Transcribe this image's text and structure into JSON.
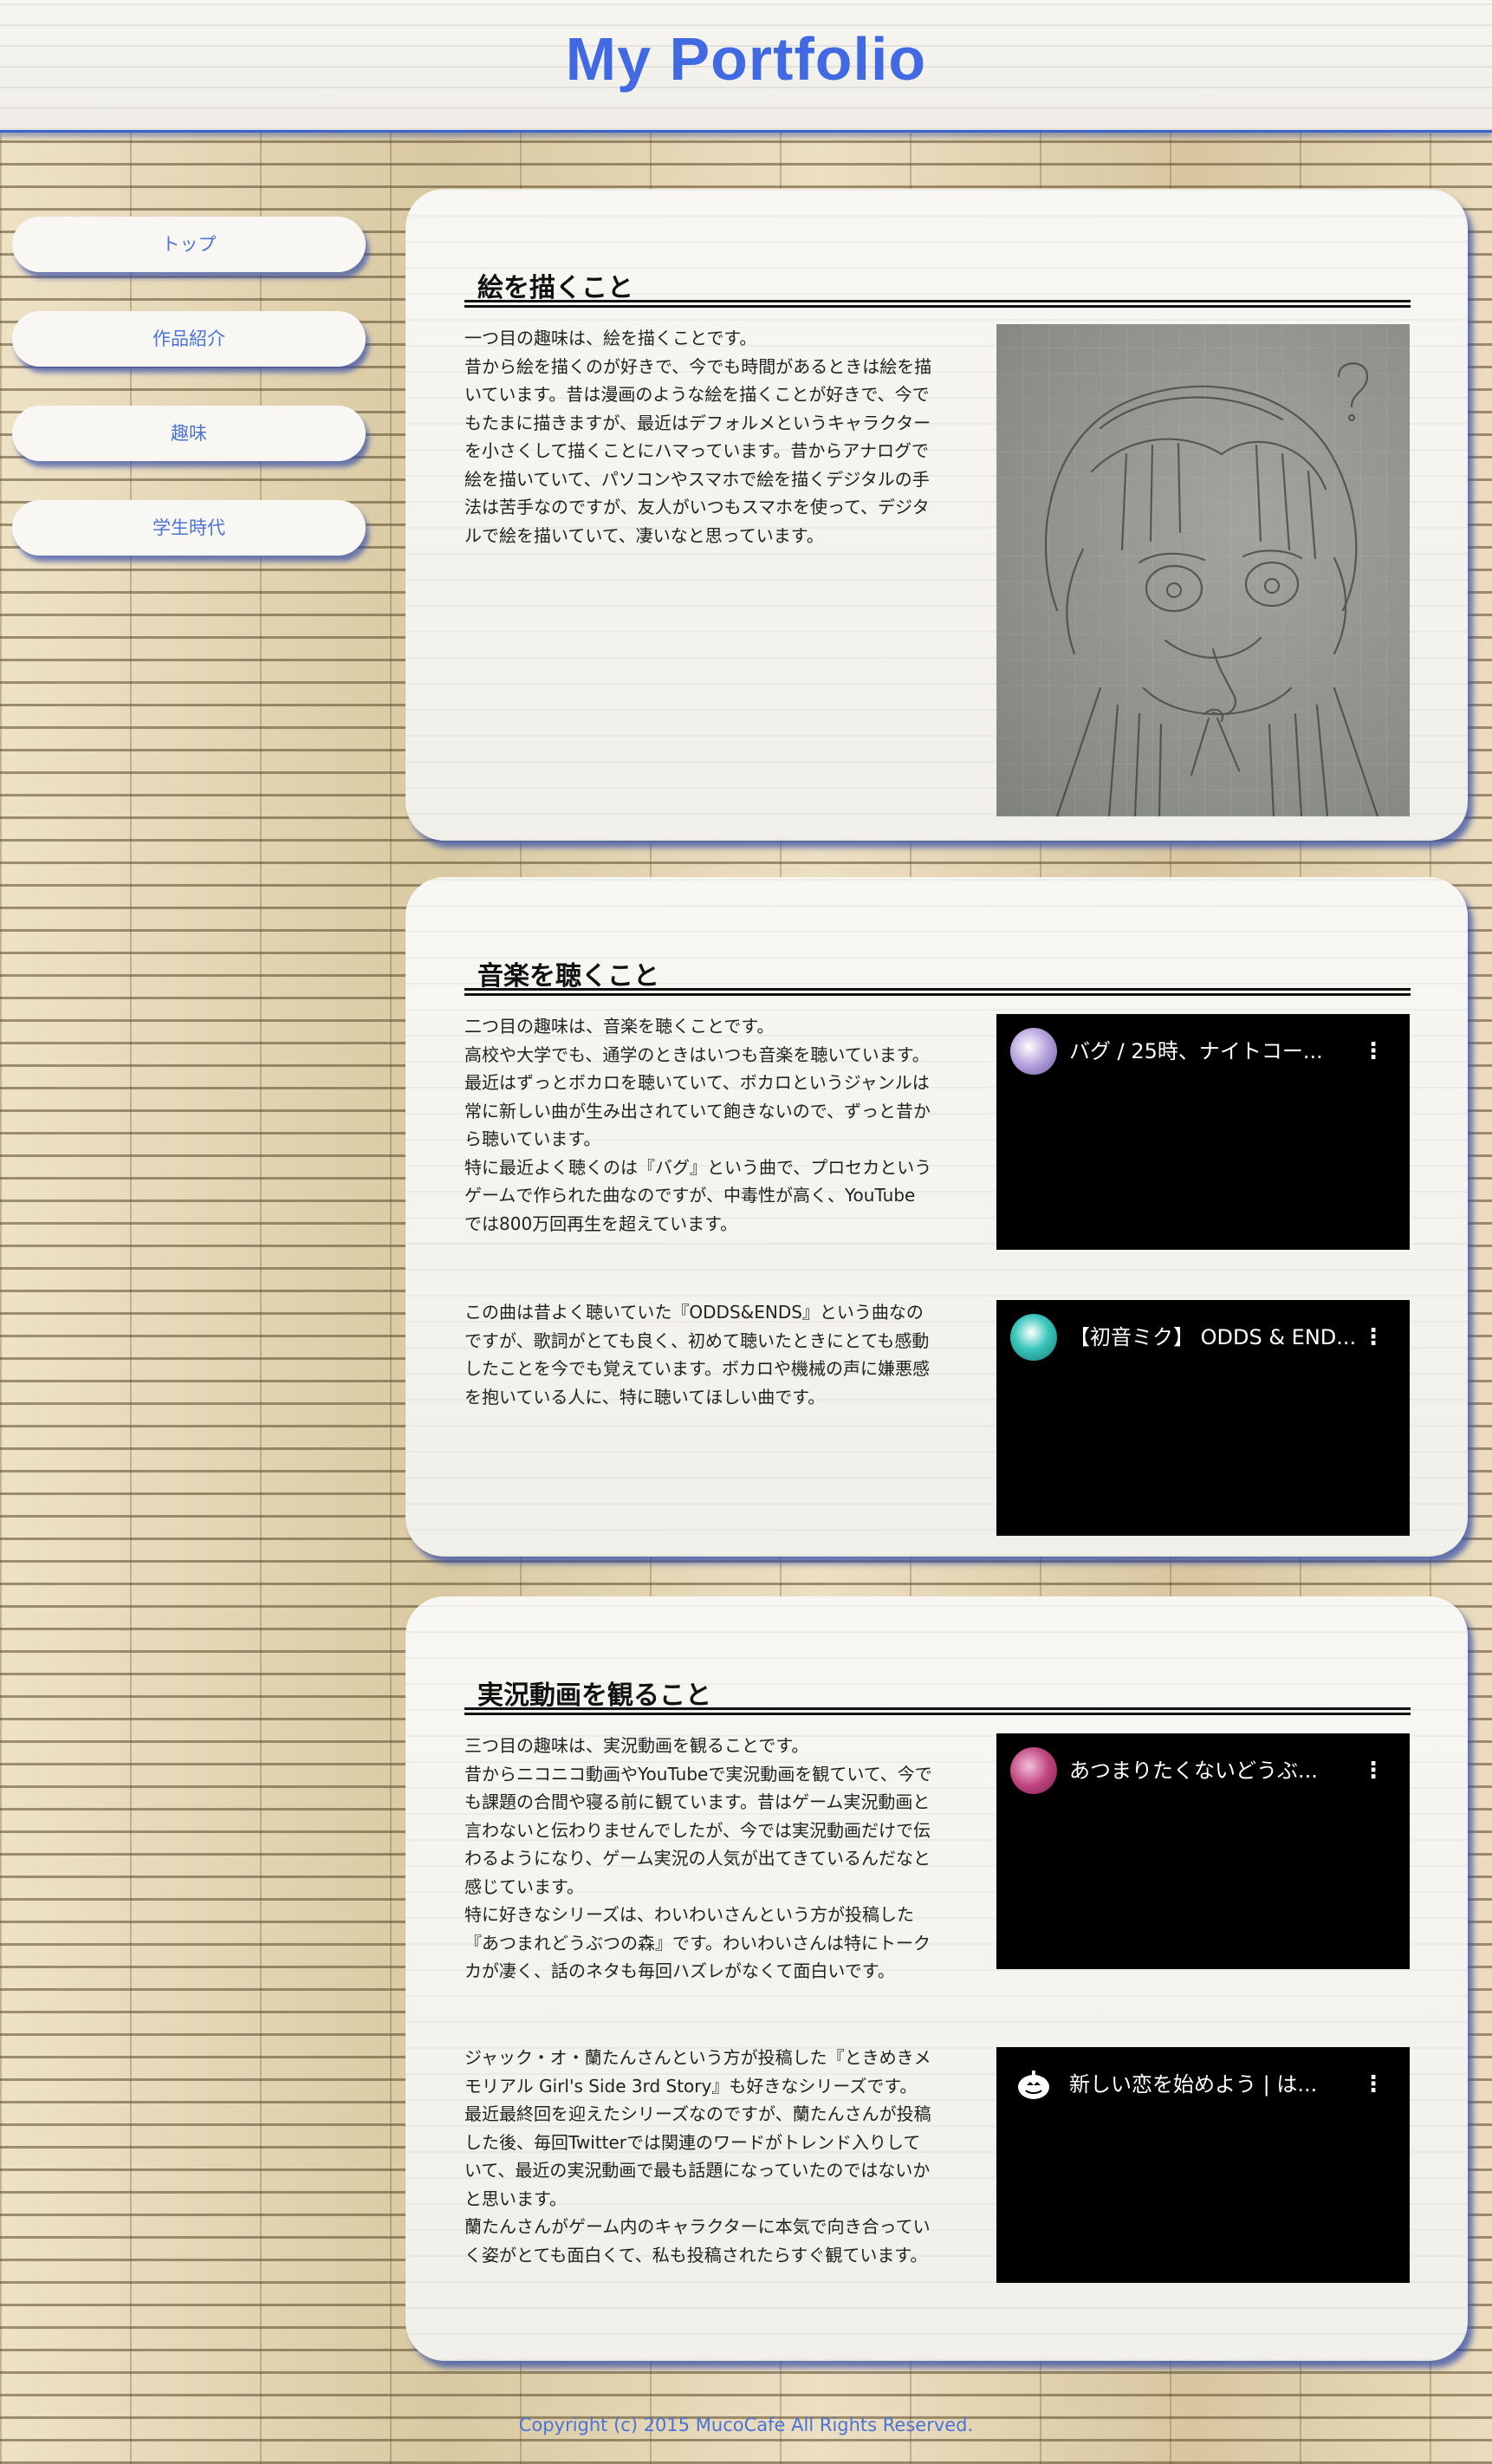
{
  "header": {
    "title": "My Portfolio"
  },
  "nav": {
    "items": [
      {
        "label": "トップ"
      },
      {
        "label": "作品紹介"
      },
      {
        "label": "趣味"
      },
      {
        "label": "学生時代"
      }
    ]
  },
  "sections": [
    {
      "title": "絵を描くこと",
      "paragraphs": [
        "一つ目の趣味は、絵を描くことです。\n昔から絵を描くのが好きで、今でも時間があるときは絵を描いています。昔は漫画のような絵を描くことが好きで、今でもたまに描きますが、最近はデフォルメというキャラクターを小さくして描くことにハマっています。昔からアナログで絵を描いていて、パソコンやスマホで絵を描くデジタルの手法は苦手なのですが、友人がいつもスマホを使って、デジタルで絵を描いていて、凄いなと思っています。"
      ]
    },
    {
      "title": "音楽を聴くこと",
      "paragraphs": [
        "二つ目の趣味は、音楽を聴くことです。\n高校や大学でも、通学のときはいつも音楽を聴いています。最近はずっとボカロを聴いていて、ボカロというジャンルは常に新しい曲が生み出されていて飽きないので、ずっと昔から聴いています。\n特に最近よく聴くのは『バグ』という曲で、プロセカというゲームで作られた曲なのですが、中毒性が高く、YouTubeでは800万回再生を超えています。",
        "この曲は昔よく聴いていた『ODDS&ENDS』という曲なのですが、歌詞がとても良く、初めて聴いたときにとても感動したことを今でも覚えています。ボカロや機械の声に嫌悪感を抱いている人に、特に聴いてほしい曲です。"
      ],
      "videos": [
        {
          "title": "バグ / 25時、ナイトコー...",
          "avatar_color": "#b9a6e0",
          "avatar_icon": "channel-avatar"
        },
        {
          "title": "【初音ミク】 ODDS & END...",
          "avatar_color": "#39c5bb",
          "avatar_icon": "channel-avatar"
        }
      ]
    },
    {
      "title": "実況動画を観ること",
      "paragraphs": [
        "三つ目の趣味は、実況動画を観ることです。\n昔からニコニコ動画やYouTubeで実況動画を観ていて、今でも課題の合間や寝る前に観ています。昔はゲーム実況動画と言わないと伝わりませんでしたが、今では実況動画だけで伝わるようになり、ゲーム実況の人気が出てきているんだなと感じています。\n特に好きなシリーズは、わいわいさんという方が投稿した『あつまれどうぶつの森』です。わいわいさんは特にトークカが凄く、話のネタも毎回ハズレがなくて面白いです。",
        "ジャック・オ・蘭たんさんという方が投稿した『ときめきメモリアル Girl's Side 3rd Story』も好きなシリーズです。最近最終回を迎えたシリーズなのですが、蘭たんさんが投稿した後、毎回Twitterでは関連のワードがトレンド入りしていて、最近の実況動画で最も話題になっていたのではないかと思います。\n蘭たんさんがゲーム内のキャラクターに本気で向き合っていく姿がとても面白くて、私も投稿されたらすぐ観ています。"
      ],
      "videos": [
        {
          "title": "あつまりたくないどうぶ...",
          "avatar_color": "#c0447f",
          "avatar_icon": "channel-avatar"
        },
        {
          "title": "新しい恋を始めよう | は...",
          "avatar_color": "#000000",
          "avatar_icon": "pumpkin-icon"
        }
      ]
    }
  ],
  "footer": {
    "text": "Copyright (c) 2015 MucoCafe All Rights Reserved."
  }
}
